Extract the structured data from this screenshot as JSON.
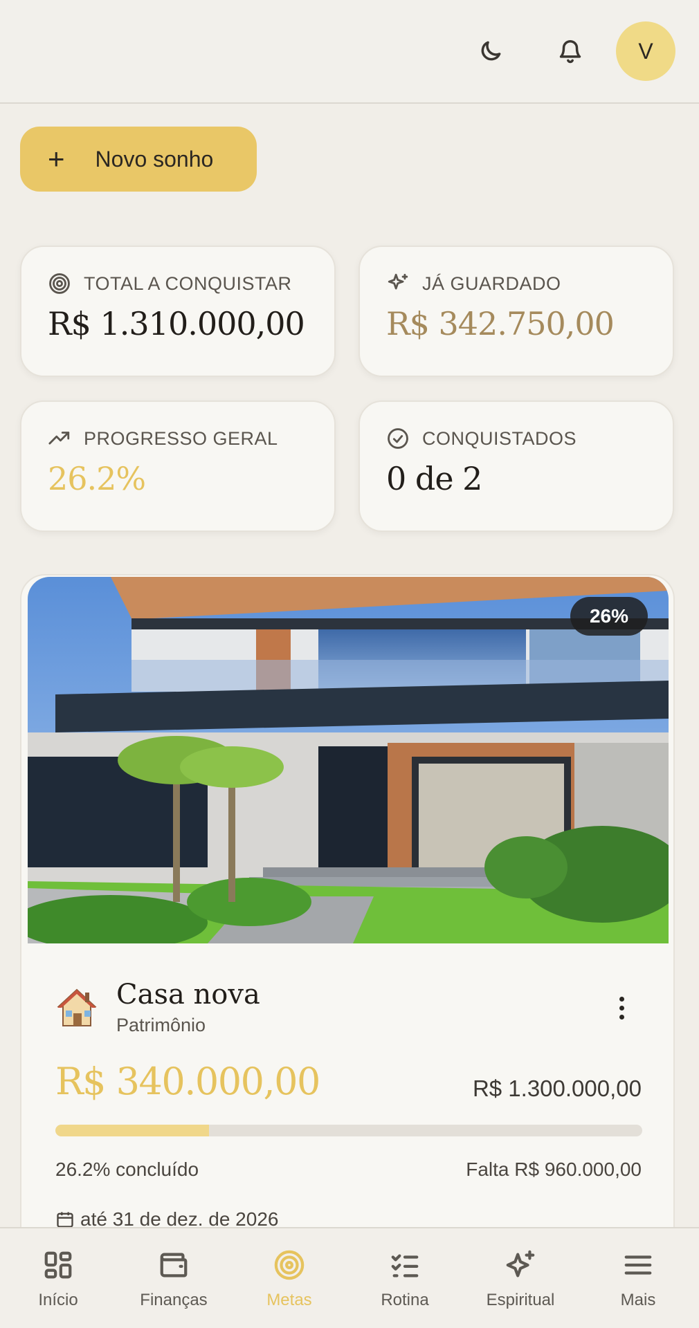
{
  "header": {
    "avatar_initial": "V",
    "theme_icon": "moon-icon",
    "notifications_icon": "bell-icon"
  },
  "actions": {
    "new_dream_label": "Novo sonho"
  },
  "stats": [
    {
      "label": "TOTAL A CONQUISTAR",
      "value": "R$ 1.310.000,00",
      "icon": "target-icon",
      "value_color": "#221e1a"
    },
    {
      "label": "JÁ GUARDADO",
      "value": "R$ 342.750,00",
      "icon": "sparkles-icon",
      "value_color": "#a58a5c"
    },
    {
      "label": "PROGRESSO GERAL",
      "value": "26.2%",
      "icon": "trending-up-icon",
      "value_color": "#e6c35e"
    },
    {
      "label": "CONQUISTADOS",
      "value": "0 de 2",
      "icon": "check-circle-icon",
      "value_color": "#221e1a"
    }
  ],
  "goal": {
    "badge": "26%",
    "title": "Casa nova",
    "category": "Patrimônio",
    "saved": "R$ 340.000,00",
    "target": "R$ 1.300.000,00",
    "progress": 0.262,
    "done_label": "26.2% concluído",
    "remaining_label": "Falta R$ 960.000,00",
    "deadline": "até 31 de dez. de 2026"
  },
  "nav": {
    "items": [
      {
        "label": "Início",
        "icon": "grid-icon"
      },
      {
        "label": "Finanças",
        "icon": "wallet-icon"
      },
      {
        "label": "Metas",
        "icon": "target-icon",
        "active": true
      },
      {
        "label": "Rotina",
        "icon": "checklist-icon"
      },
      {
        "label": "Espiritual",
        "icon": "sparkles-icon"
      },
      {
        "label": "Mais",
        "icon": "menu-icon"
      }
    ]
  },
  "colors": {
    "accent": "#e9c767",
    "accent_text": "#e6c35e",
    "background": "#f1eee8",
    "card": "#f8f7f3"
  }
}
